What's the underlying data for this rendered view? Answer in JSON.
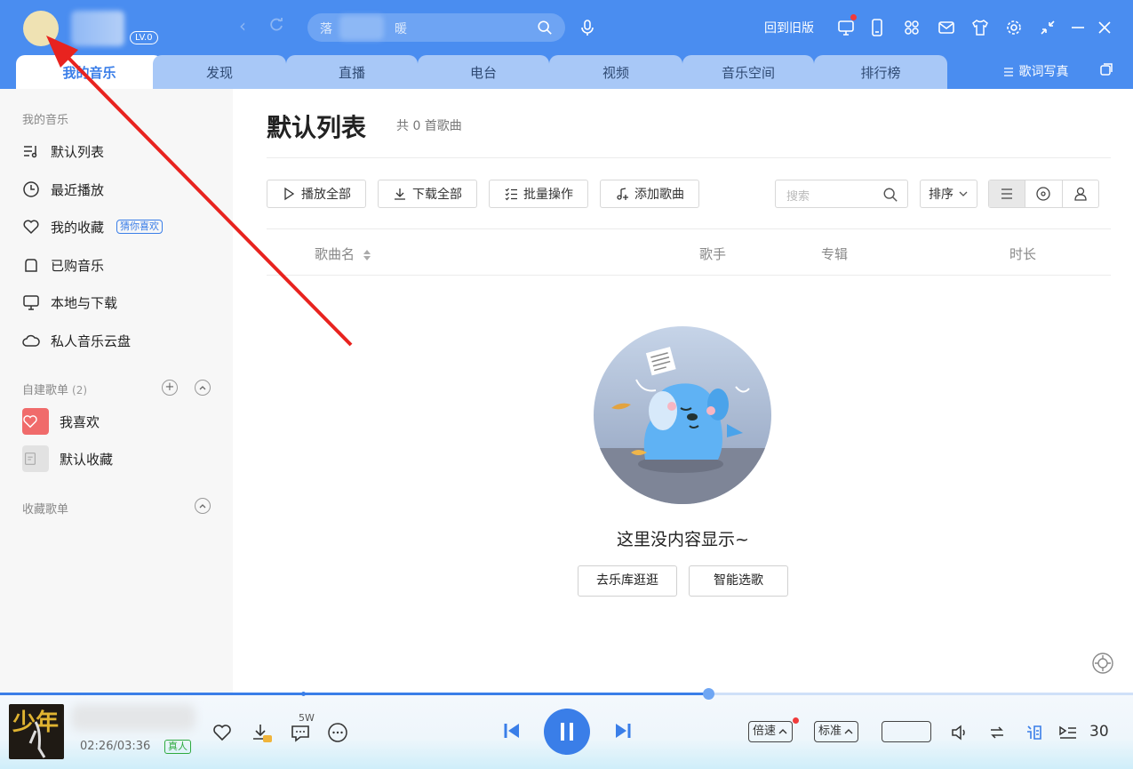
{
  "header": {
    "level": "LV.0",
    "search_placeholder_start": "落",
    "search_placeholder_end": "暖",
    "back_old": "回到旧版",
    "tabs": [
      "我的音乐",
      "发现",
      "直播",
      "电台",
      "视频",
      "音乐空间",
      "排行榜"
    ],
    "active_tab_index": 0,
    "lyric_wallpaper": "歌词写真"
  },
  "sidebar": {
    "my_music_title": "我的音乐",
    "items": [
      {
        "label": "默认列表",
        "icon": "playlist-icon"
      },
      {
        "label": "最近播放",
        "icon": "clock-icon"
      },
      {
        "label": "我的收藏",
        "icon": "heart-icon",
        "badge": "猜你喜欢"
      },
      {
        "label": "已购音乐",
        "icon": "bag-icon"
      },
      {
        "label": "本地与下载",
        "icon": "monitor-icon"
      },
      {
        "label": "私人音乐云盘",
        "icon": "cloud-icon"
      }
    ],
    "created_title": "自建歌单",
    "created_count": "(2)",
    "created_playlists": [
      "我喜欢",
      "默认收藏"
    ],
    "collected_title": "收藏歌单"
  },
  "main": {
    "title": "默认列表",
    "count": "共 0 首歌曲",
    "actions": [
      "播放全部",
      "下载全部",
      "批量操作",
      "添加歌曲"
    ],
    "search_placeholder": "搜索",
    "sort_label": "排序",
    "columns": {
      "name": "歌曲名",
      "artist": "歌手",
      "album": "专辑",
      "duration": "时长"
    },
    "empty_text": "这里没内容显示~",
    "empty_buttons": [
      "去乐库逛逛",
      "智能选歌"
    ]
  },
  "player": {
    "album_text": "少年",
    "time": "02:26/03:36",
    "real_badge": "真人",
    "comment_count": "5W",
    "speed_label": "倍速",
    "quality_label": "标准",
    "volume": "30",
    "progress": 0.625
  },
  "colors": {
    "header_bg": "#4a8df0",
    "accent": "#3a7ee8",
    "annotation_arrow": "#e8231f"
  }
}
